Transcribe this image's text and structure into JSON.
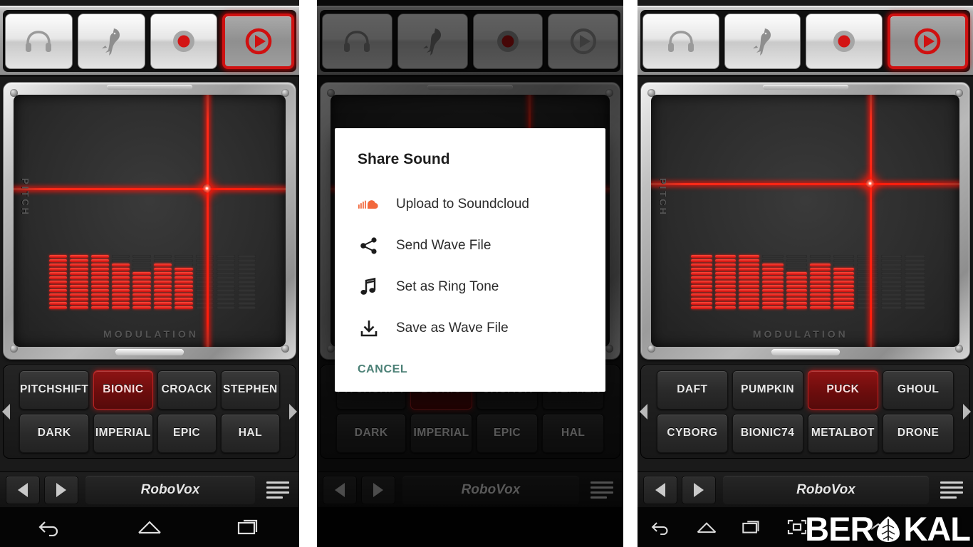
{
  "app": {
    "name": "RoboVox"
  },
  "toolbar": {
    "buttons": [
      {
        "id": "monitor",
        "icon": "headphones-icon",
        "active": false
      },
      {
        "id": "voice",
        "icon": "parrot-icon",
        "active": false
      },
      {
        "id": "record",
        "icon": "record-icon",
        "active": false
      },
      {
        "id": "play",
        "icon": "play-icon",
        "active": true
      }
    ]
  },
  "pad": {
    "y_label": "PITCH",
    "x_label": "MODULATION",
    "panels": [
      {
        "crosshair_x_pct": 71,
        "crosshair_y_pct": 37
      },
      {
        "crosshair_x_pct": 71,
        "crosshair_y_pct": 37
      },
      {
        "crosshair_x_pct": 71,
        "crosshair_y_pct": 35
      }
    ]
  },
  "presets_left": {
    "items": [
      {
        "label": "PITCH\nSHIFT",
        "selected": false
      },
      {
        "label": "BIONIC",
        "selected": true
      },
      {
        "label": "CROACK",
        "selected": false
      },
      {
        "label": "STEPHEN",
        "selected": false
      },
      {
        "label": "DARK",
        "selected": false
      },
      {
        "label": "IMPERIAL",
        "selected": false
      },
      {
        "label": "EPIC",
        "selected": false
      },
      {
        "label": "HAL",
        "selected": false
      }
    ]
  },
  "presets_right": {
    "items": [
      {
        "label": "DAFT",
        "selected": false
      },
      {
        "label": "PUMPKIN",
        "selected": false
      },
      {
        "label": "PUCK",
        "selected": true
      },
      {
        "label": "GHOUL",
        "selected": false
      },
      {
        "label": "CYBORG",
        "selected": false
      },
      {
        "label": "BIONIC74",
        "selected": false
      },
      {
        "label": "METAL\nBOT",
        "selected": false
      },
      {
        "label": "DRONE",
        "selected": false
      }
    ]
  },
  "transport": {
    "prev": "prev-preset-icon",
    "next": "next-preset-icon",
    "title": "RoboVox",
    "menu": "menu-icon"
  },
  "dialog": {
    "title": "Share Sound",
    "items": [
      {
        "label": "Upload to Soundcloud",
        "icon": "soundcloud-icon"
      },
      {
        "label": "Send Wave File",
        "icon": "share-icon"
      },
      {
        "label": "Set as Ring Tone",
        "icon": "music-note-icon"
      },
      {
        "label": "Save as Wave File",
        "icon": "download-icon"
      }
    ],
    "cancel_label": "CANCEL"
  },
  "navbar": {
    "back": "back-icon",
    "home": "home-icon",
    "recents": "recents-icon",
    "screenshot": "screenshot-icon",
    "expand": "expand-icon"
  },
  "watermark": {
    "before": "BER",
    "after": "KAL",
    "logo": "leaf-brain-logo"
  },
  "colors": {
    "accent_red": "#cc0d0d",
    "soundcloud_orange": "#f2683c",
    "cancel_teal": "#4b8076",
    "panel_dark": "#1a1a1a"
  }
}
